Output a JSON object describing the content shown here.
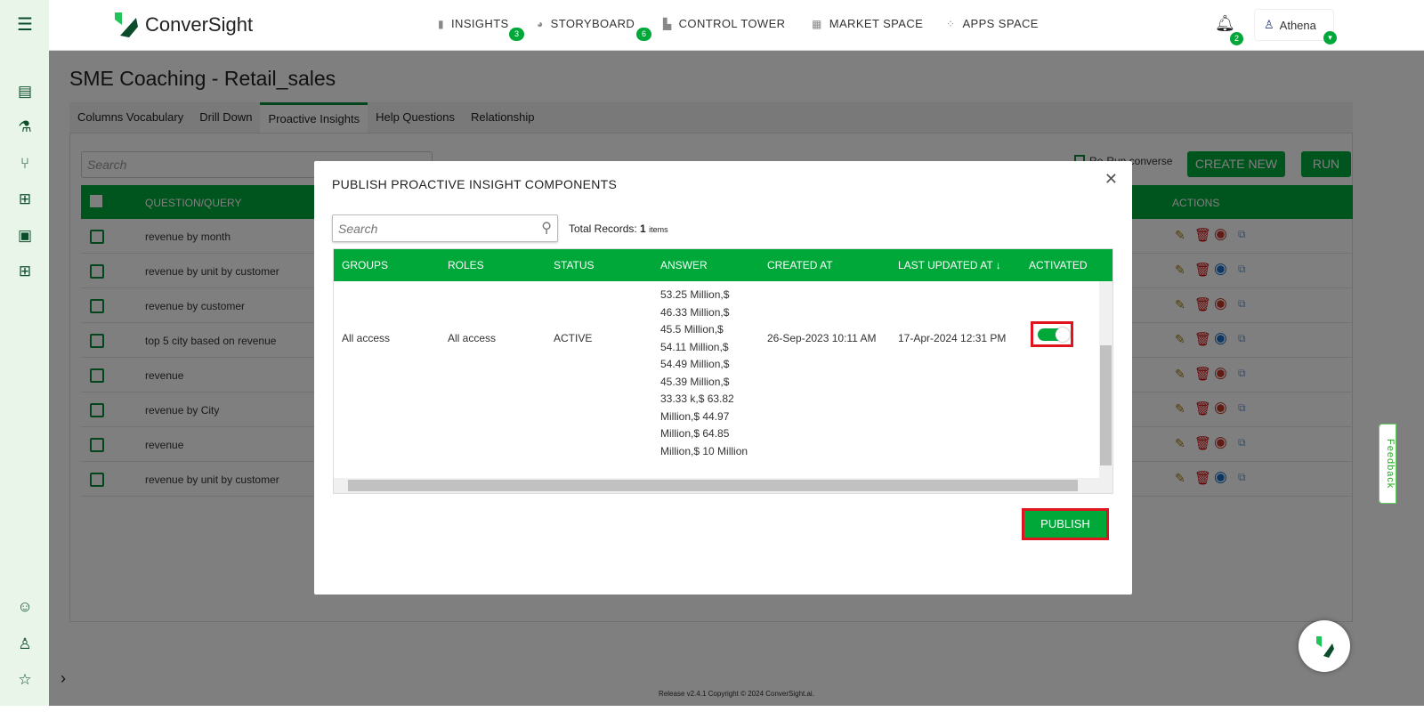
{
  "sidebar": {
    "icons": [
      "menu-icon",
      "report-icon",
      "flask-icon",
      "branch-icon",
      "hierarchy-icon",
      "presentation-icon",
      "org-chart-icon",
      "bot-face-icon",
      "users-icon",
      "star-icon",
      "expand-chevron-icon"
    ]
  },
  "header": {
    "brand": "ConverSight",
    "nav": [
      {
        "label": "INSIGHTS",
        "badge": "3",
        "icon": "bar-chart-icon"
      },
      {
        "label": "STORYBOARD",
        "badge": "6",
        "icon": "gauge-icon"
      },
      {
        "label": "CONTROL TOWER",
        "icon": "factory-icon"
      },
      {
        "label": "MARKET SPACE",
        "icon": "store-icon"
      },
      {
        "label": "APPS SPACE",
        "icon": "grid-icon"
      }
    ],
    "notifications": "2",
    "user": "Athena"
  },
  "page": {
    "title": "SME Coaching - Retail_sales",
    "tabs": [
      "Columns Vocabulary",
      "Drill Down",
      "Proactive Insights",
      "Help Questions",
      "Relationship"
    ],
    "active_tab": "Proactive Insights",
    "search_placeholder": "Search",
    "rerun": "Re-Run converse",
    "create_new": "CREATE NEW",
    "run": "RUN",
    "table": {
      "headers": [
        "QUESTION/QUERY",
        "ACTIONS"
      ],
      "rows": [
        {
          "q": "revenue by month",
          "eye": "red"
        },
        {
          "q": "revenue by unit by customer",
          "eye": "blue"
        },
        {
          "q": "revenue by customer",
          "eye": "red"
        },
        {
          "q": "top 5 city based on revenue",
          "eye": "blue"
        },
        {
          "q": "revenue",
          "eye": "red"
        },
        {
          "q": "revenue by City",
          "eye": "red"
        },
        {
          "q": "revenue",
          "eye": "red"
        },
        {
          "q": "revenue by unit by customer",
          "eye": "blue"
        }
      ]
    }
  },
  "footer": "Release v2.4.1 Copyright © 2024 ConverSight.ai.",
  "feedback": "Feedback",
  "modal": {
    "title": "PUBLISH PROACTIVE INSIGHT COMPONENTS",
    "search_placeholder": "Search",
    "total_label": "Total Records:",
    "total_count": "1",
    "total_unit": "items",
    "headers": [
      "GROUPS",
      "ROLES",
      "STATUS",
      "ANSWER",
      "CREATED AT",
      "LAST UPDATED AT ↓",
      "ACTIVATED"
    ],
    "row": {
      "groups": "All access",
      "roles": "All access",
      "status": "ACTIVE",
      "answer": "53.25 Million,$ 46.33 Million,$ 45.5 Million,$ 54.11 Million,$ 54.49 Million,$ 45.39 Million,$ 33.33 k,$ 63.82 Million,$ 44.97 Million,$ 64.85 Million,$ 10 Million",
      "created": "26-Sep-2023 10:11 AM",
      "updated": "17-Apr-2024 12:31 PM",
      "activated": true
    },
    "publish": "PUBLISH"
  },
  "colors": {
    "accent": "#00a83a",
    "highlight": "#e0141e",
    "eye_red": "#c0392b",
    "eye_blue": "#1a6fc4"
  }
}
